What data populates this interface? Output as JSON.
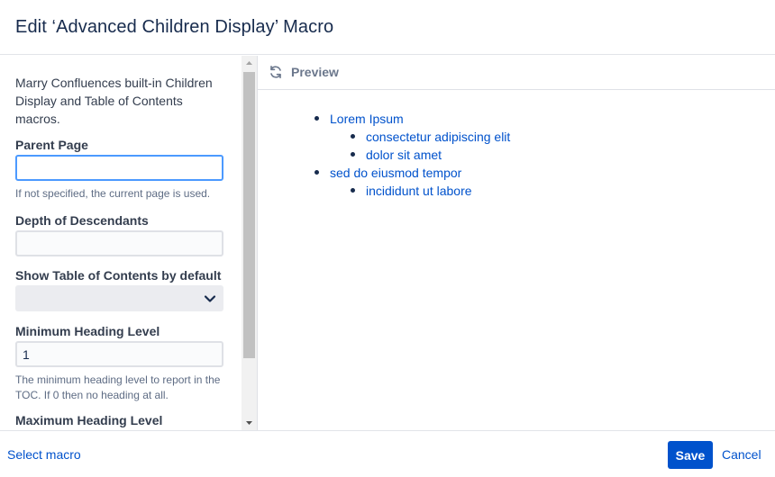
{
  "dialog": {
    "title": "Edit ‘Advanced Children Display’ Macro"
  },
  "form": {
    "description": "Marry Confluences built-in Children Display and Table of Contents macros.",
    "parent_page": {
      "label": "Parent Page",
      "value": "",
      "hint": "If not specified, the current page is used."
    },
    "depth": {
      "label": "Depth of Descendants",
      "value": ""
    },
    "show_toc": {
      "label": "Show Table of Contents by default",
      "selected": ""
    },
    "min_heading": {
      "label": "Minimum Heading Level",
      "value": "1",
      "hint": "The minimum heading level to report in the TOC. If 0 then no heading at all."
    },
    "max_heading": {
      "label": "Maximum Heading Level"
    }
  },
  "preview": {
    "title": "Preview",
    "items": [
      {
        "label": "Lorem Ipsum",
        "children": [
          "consectetur adipiscing elit",
          "dolor sit amet"
        ]
      },
      {
        "label": "sed do eiusmod tempor",
        "children": [
          "incididunt ut labore"
        ]
      }
    ]
  },
  "footer": {
    "select_macro": "Select macro",
    "save": "Save",
    "cancel": "Cancel"
  },
  "colors": {
    "primary": "#0052cc",
    "text": "#172b4d",
    "focus": "#4c9aff"
  },
  "icons": {
    "refresh": "refresh-icon",
    "dropdown": "chevron-down-icon"
  }
}
